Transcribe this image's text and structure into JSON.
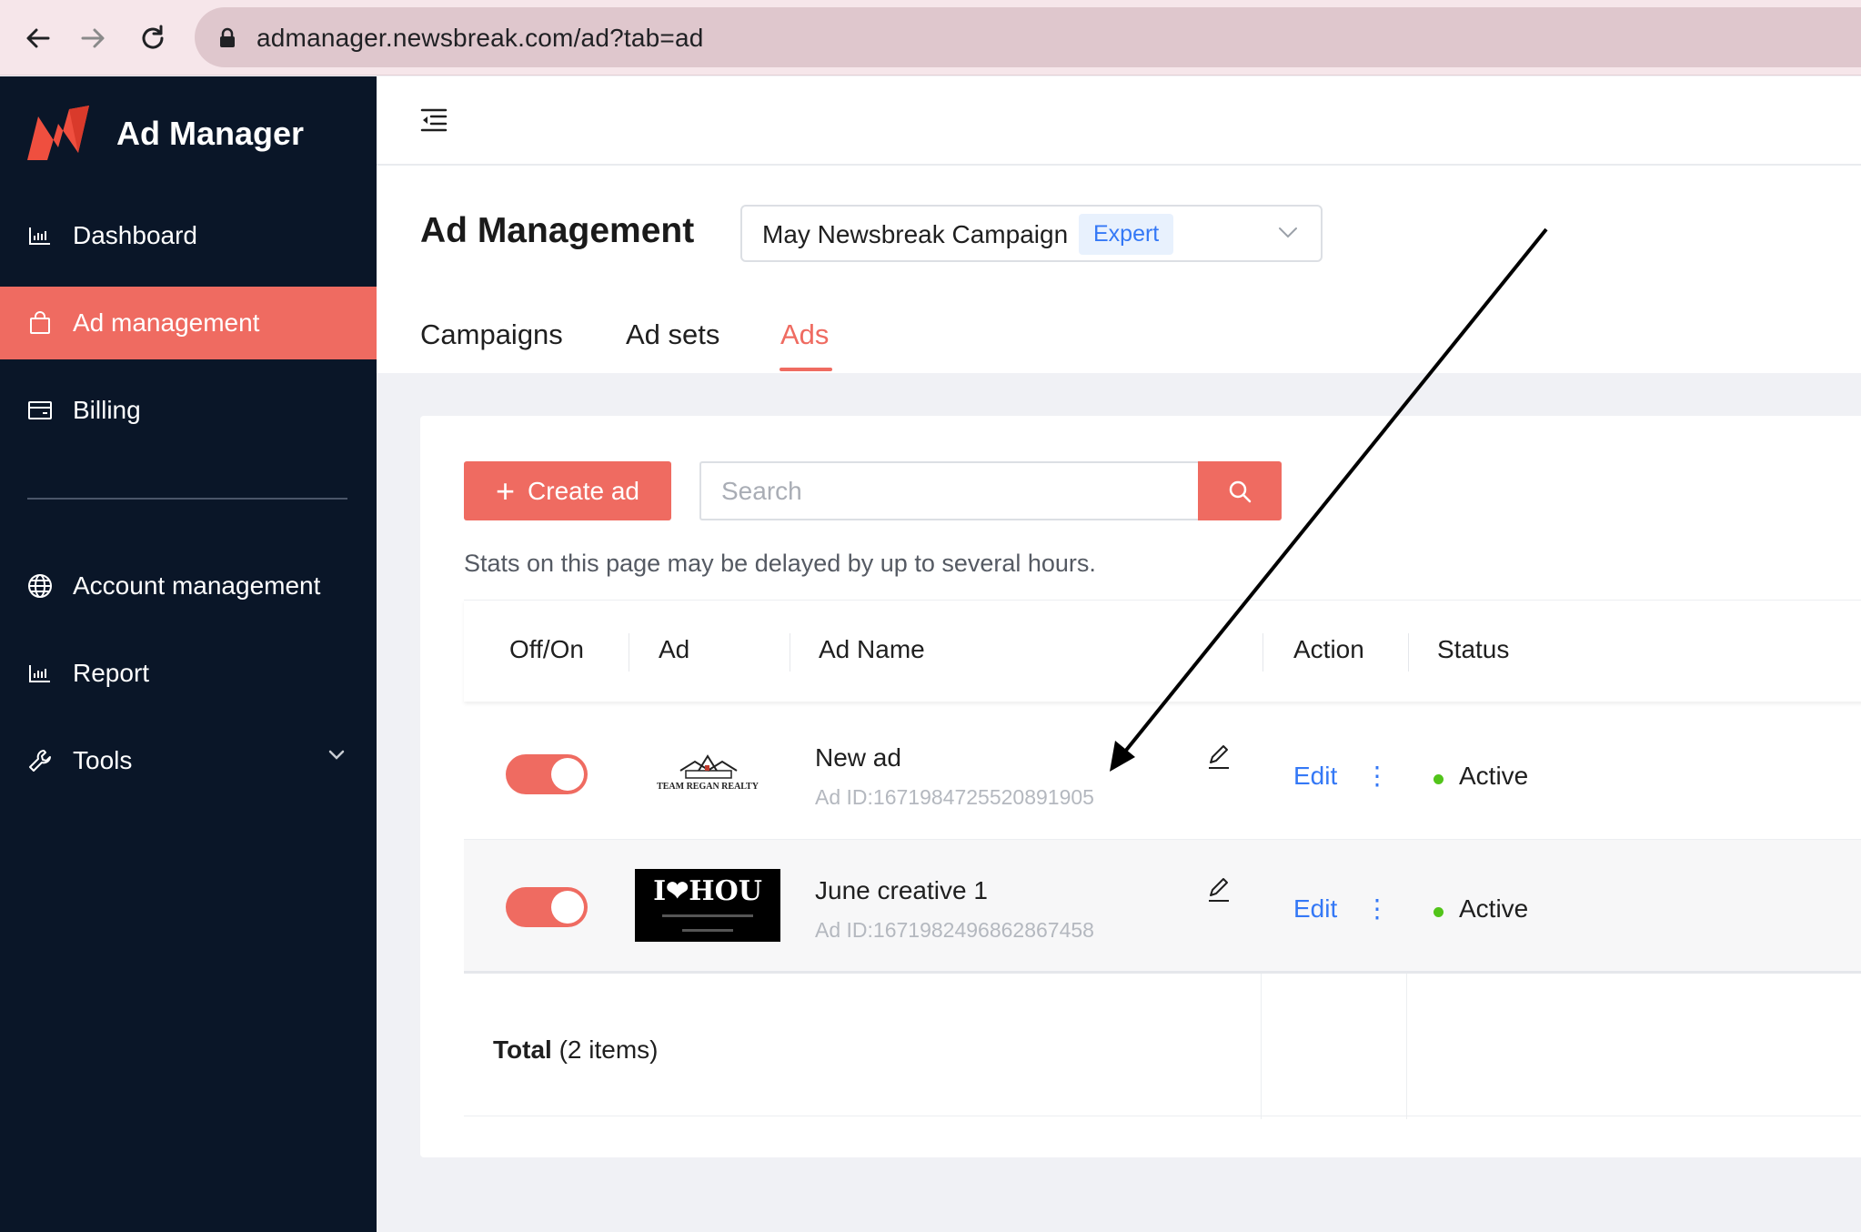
{
  "browser": {
    "url": "admanager.newsbreak.com/ad?tab=ad"
  },
  "sidebar": {
    "brand_title": "Ad Manager",
    "items": [
      {
        "label": "Dashboard",
        "icon": "bar-chart-icon"
      },
      {
        "label": "Ad management",
        "icon": "bag-icon",
        "active": true
      },
      {
        "label": "Billing",
        "icon": "card-icon"
      },
      {
        "label": "Account management",
        "icon": "globe-icon"
      },
      {
        "label": "Report",
        "icon": "bar-chart-icon"
      },
      {
        "label": "Tools",
        "icon": "wrench-icon"
      }
    ]
  },
  "header": {
    "title": "Ad Management",
    "campaign": {
      "name": "May Newsbreak Campaign",
      "badge": "Expert"
    },
    "tabs": [
      {
        "label": "Campaigns"
      },
      {
        "label": "Ad sets"
      },
      {
        "label": "Ads",
        "active": true
      }
    ]
  },
  "toolbar": {
    "create_label": "Create ad",
    "search_placeholder": "Search",
    "notice": "Stats on this page may be delayed by up to several hours."
  },
  "table": {
    "columns": [
      "Off/On",
      "Ad",
      "Ad Name",
      "Action",
      "Status"
    ],
    "rows": [
      {
        "name": "New ad",
        "id": "Ad ID:1671984725520891905",
        "action": "Edit",
        "status": "Active",
        "enabled": true,
        "thumb_text": "TEAM REGAN REALTY"
      },
      {
        "name": "June creative 1",
        "id": "Ad ID:1671982496862867458",
        "action": "Edit",
        "status": "Active",
        "enabled": true,
        "thumb_text": "I❤HOU"
      }
    ],
    "total_label": "Total",
    "total_count": "(2 items)"
  },
  "colors": {
    "accent": "#ef6b61",
    "sidebar_bg": "#0a1628",
    "link": "#3478f6",
    "status_active": "#52c41a"
  }
}
